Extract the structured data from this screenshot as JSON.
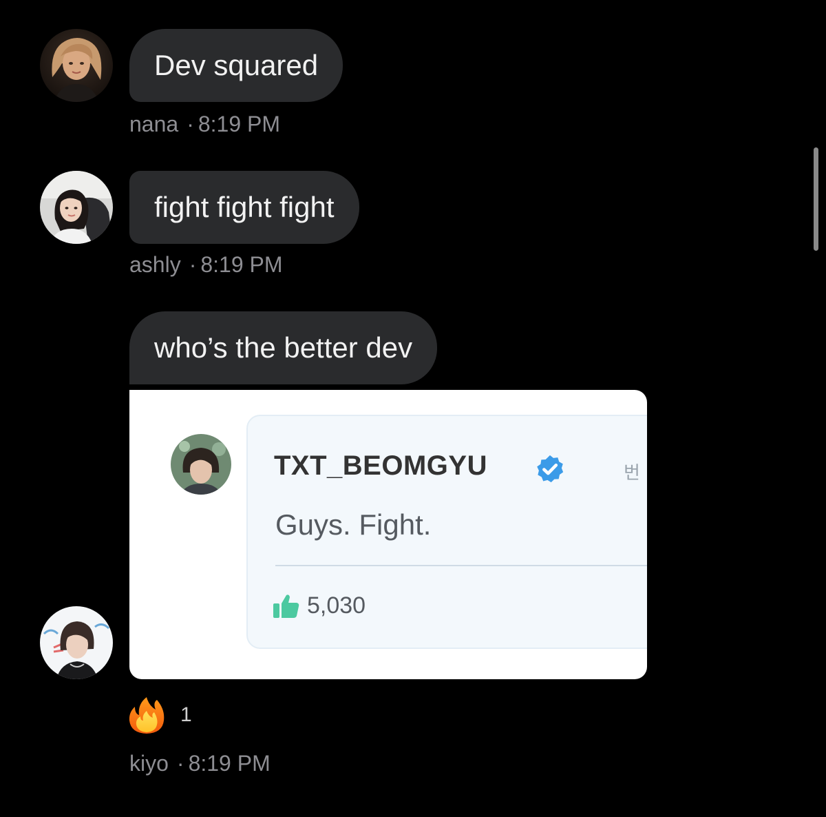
{
  "messages": [
    {
      "sender": "nana",
      "text": "Dev squared",
      "time": "8:19 PM",
      "avatar_icon": "user-avatar-nana"
    },
    {
      "sender": "ashly",
      "sender_display": "ashly",
      "text": "fight fight fight",
      "time": "8:19 PM",
      "avatar_icon": "user-avatar-ashly"
    },
    {
      "sender": "kiyo",
      "text": "who’s the better dev",
      "time": "8:19 PM",
      "avatar_icon": "user-avatar-kiyo",
      "shared_image": {
        "tweet_name": "TXT_BEOMGYU",
        "verified_icon": "verified-badge-icon",
        "tweet_text": "Guys. Fight.",
        "like_icon": "thumbs-up-icon",
        "like_count": "5,030",
        "side_glyph": "번"
      },
      "reaction": {
        "emoji_icon": "fire-emoji-icon",
        "count": "1"
      }
    }
  ],
  "separator": "·",
  "colors": {
    "background": "#000000",
    "bubble": "#2a2b2d",
    "meta_text": "#8e8e93",
    "verified_blue": "#3b9be8",
    "like_green": "#4cc9a0"
  }
}
